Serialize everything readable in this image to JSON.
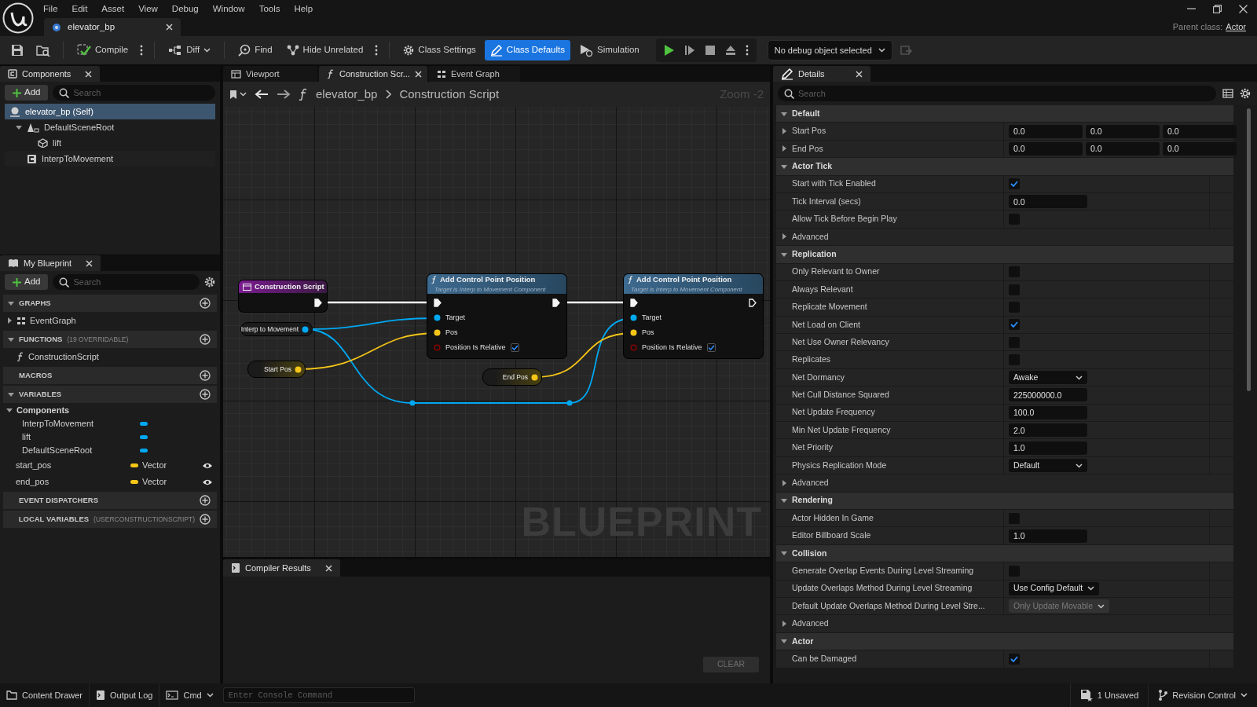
{
  "menu": [
    "File",
    "Edit",
    "Asset",
    "View",
    "Debug",
    "Window",
    "Tools",
    "Help"
  ],
  "document_tabs": [
    {
      "label": "elevator_bp",
      "selected": true
    }
  ],
  "parent_class": {
    "label": "Parent class:",
    "value": "Actor"
  },
  "toolbar": {
    "buttons": [
      {
        "label": "Compile",
        "selected": false
      },
      {
        "label": "Diff",
        "selected": false
      },
      {
        "label": "Find",
        "selected": false
      },
      {
        "label": "Hide Unrelated",
        "selected": false
      },
      {
        "label": "Class Settings",
        "selected": false
      },
      {
        "label": "Class Defaults",
        "selected": true
      },
      {
        "label": "Simulation",
        "selected": false
      }
    ],
    "debug_filter": "No debug object selected"
  },
  "components": {
    "title": "Components",
    "add": "Add",
    "search": {
      "placeholder": "Search"
    },
    "tree": [
      {
        "label": "elevator_bp (Self)",
        "selected": true,
        "children": [
          {
            "label": "DefaultSceneRoot",
            "selected": false,
            "expanded": true,
            "children": [
              {
                "label": "lift",
                "selected": false
              }
            ]
          },
          {
            "label": "InterpToMovement",
            "selected": false
          }
        ]
      }
    ]
  },
  "my_blueprint": {
    "title": "My Blueprint",
    "add": "Add",
    "search": {
      "placeholder": "Search"
    },
    "sections": [
      {
        "title": "GRAPHS",
        "expanded": true,
        "items": [
          {
            "kind": "graph",
            "label": "EventGraph",
            "expanded": false
          }
        ]
      },
      {
        "title": "FUNCTIONS",
        "note": "(19 OVERRIDABLE)",
        "expanded": true,
        "items": [
          {
            "kind": "function",
            "label": "ConstructionScript"
          }
        ]
      },
      {
        "title": "MACROS",
        "expanded": false
      },
      {
        "title": "VARIABLES",
        "expanded": true,
        "items": [
          {
            "kind": "category",
            "label": "Components",
            "expanded": true,
            "children": [
              {
                "label": "InterpToMovement",
                "color": "#00a8f2"
              },
              {
                "label": "lift",
                "color": "#00a8f2"
              },
              {
                "label": "DefaultSceneRoot",
                "color": "#00a8f2"
              }
            ]
          },
          {
            "kind": "variable",
            "label": "start_pos",
            "type": "Vector",
            "color": "#f5c518"
          },
          {
            "kind": "variable",
            "label": "end_pos",
            "type": "Vector",
            "color": "#f5c518"
          }
        ]
      },
      {
        "title": "EVENT DISPATCHERS",
        "expanded": false
      },
      {
        "title": "LOCAL VARIABLES",
        "note": "(USERCONSTRUCTIONSCRIPT)",
        "expanded": false
      }
    ]
  },
  "graph": {
    "tabs": [
      {
        "label": "Viewport",
        "selected": false
      },
      {
        "label": "Construction Scr...",
        "selected": true
      },
      {
        "label": "Event Graph",
        "selected": false
      }
    ],
    "breadcrumb": [
      "elevator_bp",
      "Construction Script"
    ],
    "zoom": "Zoom -2",
    "watermark": "BLUEPRINT",
    "nodes": [
      {
        "kind": "event",
        "title": "Construction Script"
      },
      {
        "kind": "getter",
        "label": "Interp to Movement",
        "color": "#00a8f2"
      },
      {
        "kind": "getter",
        "label": "Start Pos",
        "color": "#f5c518"
      },
      {
        "kind": "function",
        "title": "Add Control Point Position",
        "subtitle": "Target is Interp to Movement Component",
        "output_connected": true,
        "pins": [
          {
            "kind": "data",
            "label": "Target",
            "color": "#00a8f2"
          },
          {
            "kind": "data",
            "label": "Pos",
            "color": "#f5c518"
          },
          {
            "kind": "bool",
            "label": "Position Is Relative",
            "color": "#940000",
            "checked": true
          }
        ]
      },
      {
        "kind": "getter",
        "label": "End Pos",
        "color": "#f5c518"
      },
      {
        "kind": "function",
        "title": "Add Control Point Position",
        "subtitle": "Target is Interp to Movement Component",
        "output_connected": false,
        "pins": [
          {
            "kind": "data",
            "label": "Target",
            "color": "#00a8f2"
          },
          {
            "kind": "data",
            "label": "Pos",
            "color": "#f5c518"
          },
          {
            "kind": "bool",
            "label": "Position Is Relative",
            "color": "#940000",
            "checked": true
          }
        ]
      }
    ]
  },
  "compiler_results": {
    "title": "Compiler Results",
    "clear": {
      "label": "CLEAR",
      "disabled": true
    }
  },
  "details": {
    "title": "Details",
    "search": {
      "placeholder": "Search"
    },
    "sections": [
      {
        "title": "Default",
        "expanded": true,
        "rows": [
          {
            "kind": "vector",
            "label": "Start Pos",
            "expanded": false,
            "values": [
              "0.0",
              "0.0",
              "0.0"
            ]
          },
          {
            "kind": "vector",
            "label": "End Pos",
            "expanded": false,
            "values": [
              "0.0",
              "0.0",
              "0.0"
            ]
          }
        ]
      },
      {
        "title": "Actor Tick",
        "expanded": true,
        "rows": [
          {
            "kind": "checkbox",
            "label": "Start with Tick Enabled",
            "checked": true
          },
          {
            "kind": "number",
            "label": "Tick Interval (secs)",
            "value": "0.0"
          },
          {
            "kind": "checkbox",
            "label": "Allow Tick Before Begin Play",
            "checked": false
          },
          {
            "kind": "group",
            "label": "Advanced",
            "expanded": false
          }
        ]
      },
      {
        "title": "Replication",
        "expanded": true,
        "rows": [
          {
            "kind": "checkbox",
            "label": "Only Relevant to Owner",
            "checked": false
          },
          {
            "kind": "checkbox",
            "label": "Always Relevant",
            "checked": false
          },
          {
            "kind": "checkbox",
            "label": "Replicate Movement",
            "checked": false
          },
          {
            "kind": "checkbox",
            "label": "Net Load on Client",
            "checked": true
          },
          {
            "kind": "checkbox",
            "label": "Net Use Owner Relevancy",
            "checked": false
          },
          {
            "kind": "checkbox",
            "label": "Replicates",
            "checked": false
          },
          {
            "kind": "dropdown",
            "label": "Net Dormancy",
            "value": "Awake",
            "disabled": false
          },
          {
            "kind": "number",
            "label": "Net Cull Distance Squared",
            "value": "225000000.0"
          },
          {
            "kind": "number",
            "label": "Net Update Frequency",
            "value": "100.0"
          },
          {
            "kind": "number",
            "label": "Min Net Update Frequency",
            "value": "2.0"
          },
          {
            "kind": "number",
            "label": "Net Priority",
            "value": "1.0"
          },
          {
            "kind": "dropdown",
            "label": "Physics Replication Mode",
            "value": "Default",
            "disabled": false
          },
          {
            "kind": "group",
            "label": "Advanced",
            "expanded": false
          }
        ]
      },
      {
        "title": "Rendering",
        "expanded": true,
        "rows": [
          {
            "kind": "checkbox",
            "label": "Actor Hidden In Game",
            "checked": false
          },
          {
            "kind": "number",
            "label": "Editor Billboard Scale",
            "value": "1.0"
          }
        ]
      },
      {
        "title": "Collision",
        "expanded": true,
        "rows": [
          {
            "kind": "checkbox",
            "label": "Generate Overlap Events During Level Streaming",
            "checked": false
          },
          {
            "kind": "dropdown",
            "label": "Update Overlaps Method During Level Streaming",
            "value": "Use Config Default",
            "disabled": false
          },
          {
            "kind": "dropdown",
            "label": "Default Update Overlaps Method During Level Stre...",
            "value": "Only Update Movable",
            "disabled": true
          },
          {
            "kind": "group",
            "label": "Advanced",
            "expanded": false
          }
        ]
      },
      {
        "title": "Actor",
        "expanded": true,
        "rows": [
          {
            "kind": "checkbox",
            "label": "Can be Damaged",
            "checked": true
          }
        ]
      }
    ]
  },
  "status_bar": {
    "left": [
      {
        "label": "Content Drawer"
      },
      {
        "label": "Output Log"
      },
      {
        "label": "Cmd"
      }
    ],
    "console": {
      "placeholder": "Enter Console Command"
    },
    "right": [
      {
        "label": "1 Unsaved"
      },
      {
        "label": "Revision Control"
      }
    ]
  }
}
